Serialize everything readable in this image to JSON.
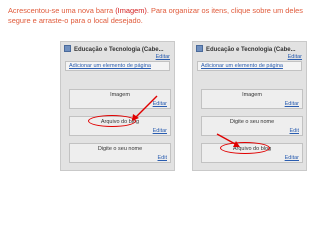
{
  "caption": {
    "pre": "Acrescentou-se uma nova barra ",
    "highlight": "(Imagem)",
    "post": ". Para organizar os itens, clique sobre um deles segure e arraste-o para o local desejado."
  },
  "colors": {
    "accent": "#e00000",
    "link": "#2a5db0",
    "caption": "#e05a3a"
  },
  "panels": {
    "left": {
      "title": "Educação e Tecnologia (Cabe...",
      "edit": "Editar",
      "add_link": "Adicionar um elemento de página",
      "gadgets": [
        {
          "label": "Imagem",
          "edit": "Editar"
        },
        {
          "label": "Arquivo do blog",
          "edit": "Editar"
        },
        {
          "label": "Digite o seu nome",
          "edit": "Edit"
        }
      ]
    },
    "right": {
      "title": "Educação e Tecnologia (Cabe...",
      "edit": "Editar",
      "add_link": "Adicionar um elemento de página",
      "gadgets": [
        {
          "label": "Imagem",
          "edit": "Editar"
        },
        {
          "label": "Digite o seu nome",
          "edit": "Edit"
        },
        {
          "label": "Arquivo do blog",
          "edit": "Editar"
        }
      ]
    }
  }
}
